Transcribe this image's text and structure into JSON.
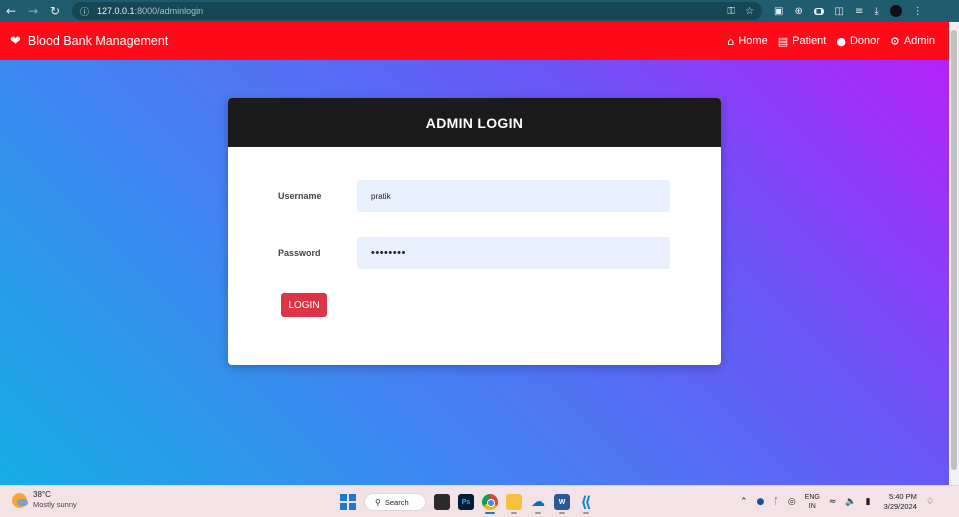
{
  "browser": {
    "info_icon": "site-info-icon",
    "url_host": "127.0.0.1",
    "url_path": ":8000/adminlogin",
    "colors": {
      "chrome_bar": "#1f5c6e",
      "address_bg": "#164754"
    }
  },
  "navbar": {
    "brand": "Blood Bank Management",
    "brand_icon": "heartbeat-icon",
    "links": [
      {
        "label": "Home",
        "icon": "home-icon"
      },
      {
        "label": "Patient",
        "icon": "bed-icon"
      },
      {
        "label": "Donor",
        "icon": "user-icon"
      },
      {
        "label": "Admin",
        "icon": "user-cog-icon"
      }
    ],
    "colors": {
      "background": "#ff0a18",
      "text": "#ffffff"
    }
  },
  "login": {
    "title": "ADMIN LOGIN",
    "username_label": "Username",
    "username_value": "pratik",
    "password_label": "Password",
    "password_value": "••••••••",
    "button_label": "LOGIN",
    "colors": {
      "header": "#1b1b1b",
      "button": "#dc3545",
      "input_bg": "#e8f0fe"
    }
  },
  "taskbar": {
    "weather_temp": "38°C",
    "weather_condition": "Mostly sunny",
    "search_label": "Search",
    "ps_label": "Ps",
    "word_label": "W",
    "lang_line1": "ENG",
    "lang_line2": "IN",
    "time": "5:40 PM",
    "date": "3/29/2024"
  }
}
